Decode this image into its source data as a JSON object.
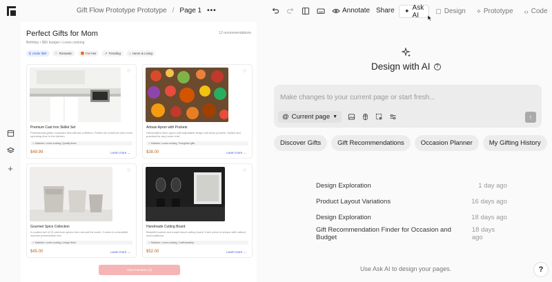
{
  "header": {
    "project": "Gift Flow Prototype Prototype",
    "separator": "/",
    "page": "Page 1",
    "more": "•••",
    "annotate": "Annotate",
    "share": "Share",
    "tabs": [
      {
        "label": "Ask AI",
        "icon": "sparkle-icon",
        "active": true
      },
      {
        "label": "Design",
        "icon": "design-icon"
      },
      {
        "label": "Prototype",
        "icon": "prototype-icon"
      },
      {
        "label": "Code",
        "icon": "code-icon"
      }
    ]
  },
  "canvas": {
    "title": "Perfect Gifts for Mom",
    "subtitle": "Birthday • $50 budget • Loves cooking",
    "count": "12 recommendations",
    "filters": [
      {
        "label": "Under $50",
        "icon": "$",
        "active": true
      },
      {
        "label": "Romantic",
        "icon": "♡"
      },
      {
        "label": "For Her",
        "icon": "🎁"
      },
      {
        "label": "Trending",
        "icon": "↗"
      },
      {
        "label": "Home & Living",
        "icon": "⌂"
      }
    ],
    "products": [
      {
        "name": "Premium Cast Iron Skillet Set",
        "desc": "Professional-grade cookware that will last a lifetime. Perfect for someone who loves spending time in the kitchen.",
        "match": "✓ Matches: Loves cooking, Quality items",
        "price": "$49.99",
        "more": "Learn more →"
      },
      {
        "name": "Artisan Apron with Pockets",
        "desc": "Handcrafted linen apron with adjustable straps and deep pockets. Stylish and practical for any home chef.",
        "match": "✓ Matches: Loves cooking, Thoughtful gifts",
        "price": "$38.00",
        "more": "Learn more →"
      },
      {
        "name": "Gourmet Spice Collection",
        "desc": "A curated set of 12 premium spices from around the world. Comes in a beautiful wooden presentation box.",
        "match": "✓ Matches: Loves cooking, Unique finds",
        "price": "$45.00",
        "more": "Learn more →"
      },
      {
        "name": "Handmade Cutting Board",
        "desc": "Beautiful walnut and maple wood cutting board. Each piece is unique with natural wood patterns.",
        "match": "✓ Matches: Loves cooking, Craftsmanship",
        "price": "$52.00",
        "more": "Learn more →"
      }
    ],
    "view_button": "View Favorites (2)"
  },
  "ai": {
    "title": "Design with AI",
    "placeholder": "Make changes to your current page or start fresh...",
    "context": "Current page",
    "suggestions": [
      "Discover Gifts",
      "Gift Recommendations",
      "Occasion Planner",
      "My Gifting History"
    ],
    "history": [
      {
        "name": "Design Exploration",
        "time": "1 day ago"
      },
      {
        "name": "Product Layout Variations",
        "time": "16 days ago"
      },
      {
        "name": "Design Exploration",
        "time": "18 days ago"
      },
      {
        "name": "Gift Recommendation Finder for Occasion and Budget",
        "time": "18 days ago"
      }
    ],
    "hint": "Use Ask AI to design your pages.",
    "help": "?"
  }
}
